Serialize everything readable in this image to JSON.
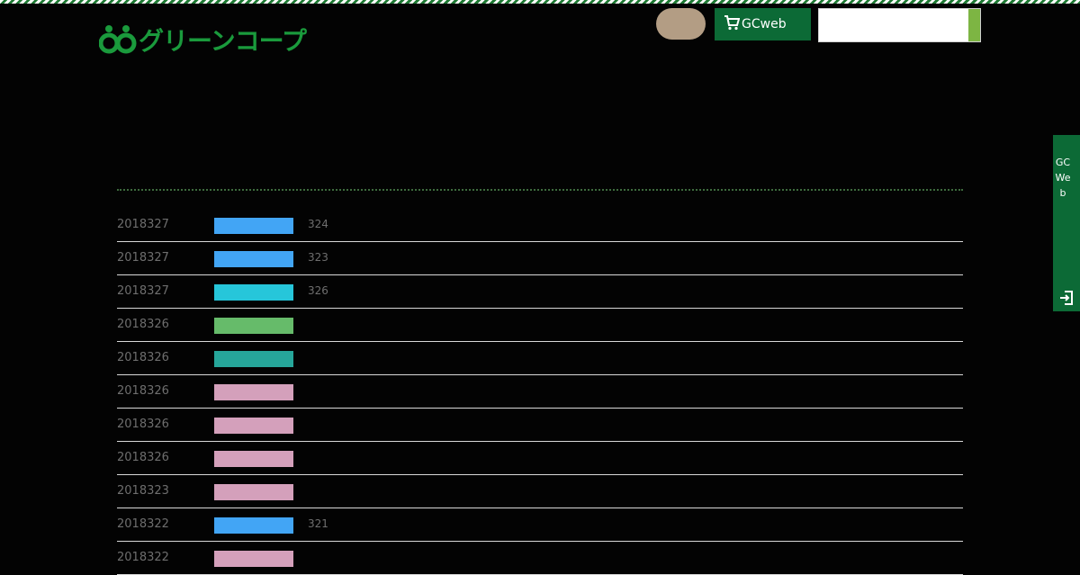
{
  "header": {
    "logo_text": "グリーンコープ",
    "gcweb_label": "GCweb",
    "search": {
      "value": "",
      "placeholder": ""
    }
  },
  "side_tab": {
    "label": "GCWeb"
  },
  "colors": {
    "brand_green": "#0c6a36",
    "accent_green": "#7db543",
    "logo_green": "#1a9a3c",
    "pill": "#b39d84"
  },
  "news": [
    {
      "date": "2018327",
      "tag_color": "#42a5f5",
      "extra": "324"
    },
    {
      "date": "2018327",
      "tag_color": "#42a5f5",
      "extra": "323"
    },
    {
      "date": "2018327",
      "tag_color": "#26c6da",
      "extra": "326"
    },
    {
      "date": "2018326",
      "tag_color": "#66bb6a",
      "extra": ""
    },
    {
      "date": "2018326",
      "tag_color": "#26a69a",
      "extra": ""
    },
    {
      "date": "2018326",
      "tag_color": "#d4a0bb",
      "extra": ""
    },
    {
      "date": "2018326",
      "tag_color": "#d4a0bb",
      "extra": ""
    },
    {
      "date": "2018326",
      "tag_color": "#d4a0bb",
      "extra": ""
    },
    {
      "date": "2018323",
      "tag_color": "#d4a0bb",
      "extra": ""
    },
    {
      "date": "2018322",
      "tag_color": "#42a5f5",
      "extra": "321"
    },
    {
      "date": "2018322",
      "tag_color": "#d4a0bb",
      "extra": ""
    }
  ]
}
